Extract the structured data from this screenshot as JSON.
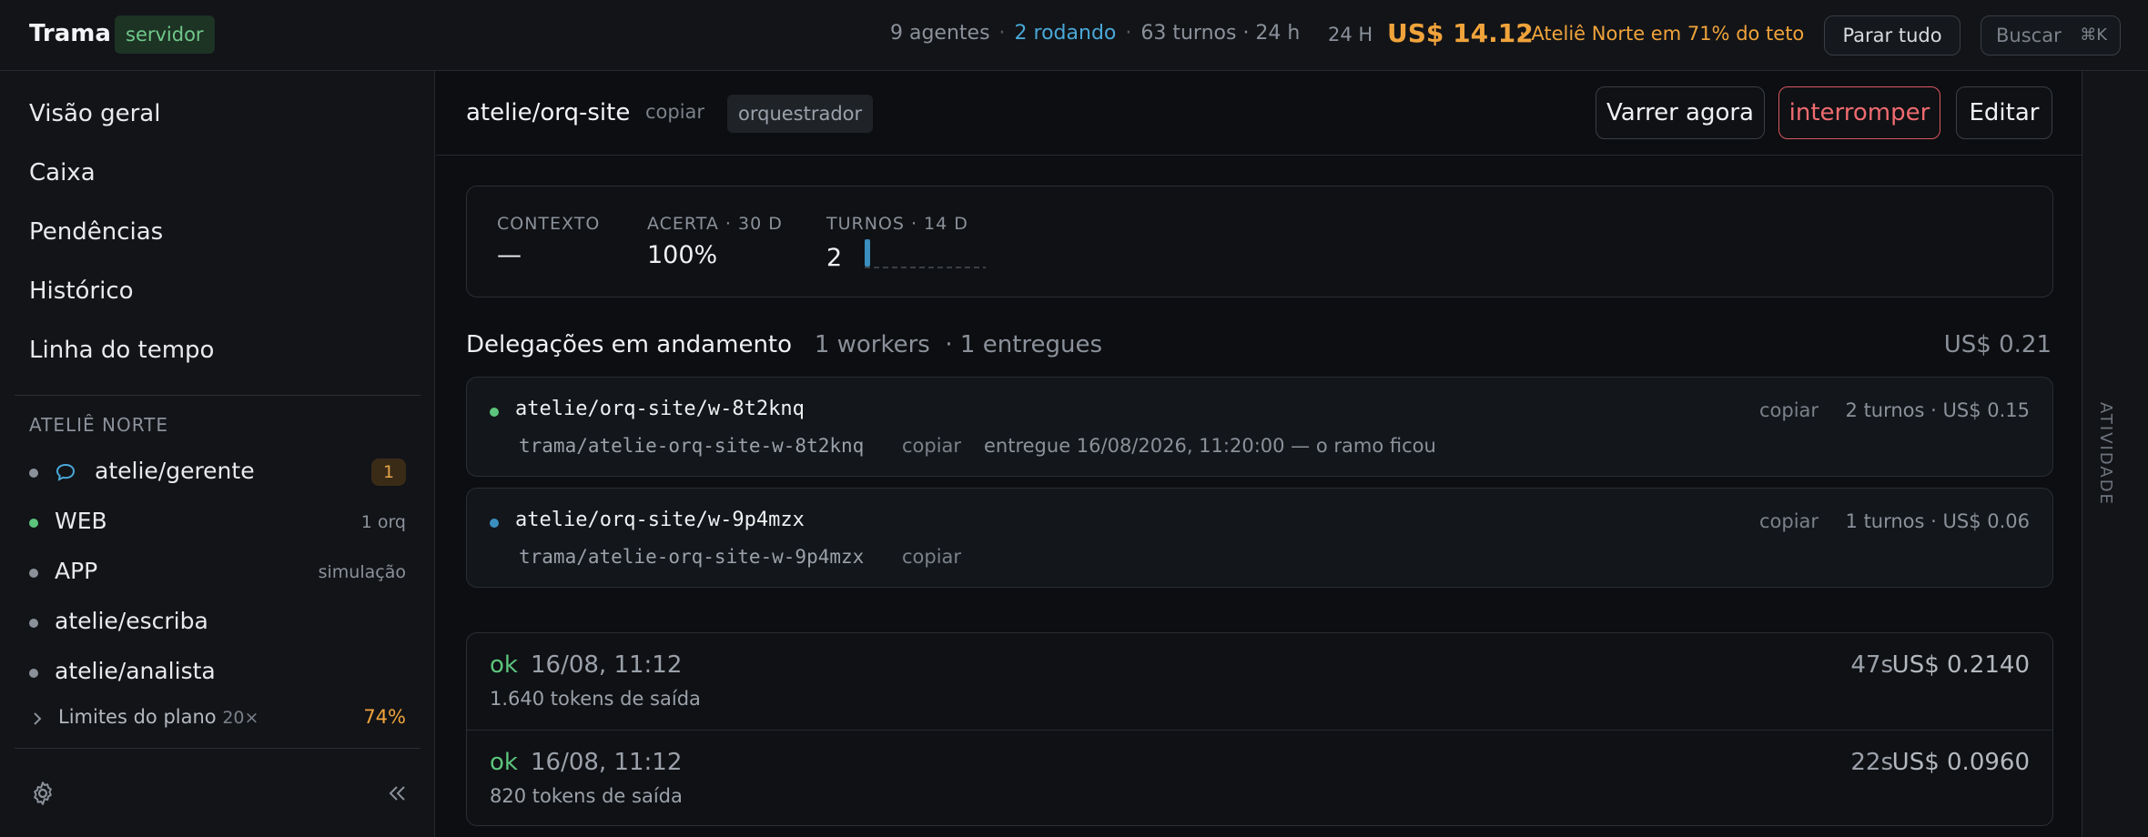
{
  "app": {
    "name": "Trama",
    "mode_tag": "servidor"
  },
  "topbar": {
    "agents": "9 agentes",
    "running": "2 rodando",
    "turns": "63 turnos · 24 h",
    "cost_label": "24 H",
    "cost": "US$ 14.12",
    "warning": "· Ateliê Norte em 71% do teto",
    "stop_all": "Parar tudo",
    "search": "Buscar",
    "search_shortcut": "⌘K"
  },
  "sidebar": {
    "nav": [
      "Visão geral",
      "Caixa",
      "Pendências",
      "Histórico",
      "Linha do tempo"
    ],
    "section_label": "ATELIÊ NORTE",
    "projects": [
      {
        "name": "atelie/gerente",
        "badge": "1",
        "dot_color": "#8b919a",
        "icon": "chat-bubble-icon"
      },
      {
        "name": "WEB",
        "meta": "1 orq",
        "dot_color": "#5cc47c"
      },
      {
        "name": "APP",
        "meta": "simulação",
        "dot_color": "#8b919a"
      },
      {
        "name": "atelie/escriba",
        "dot_color": "#8b919a"
      },
      {
        "name": "atelie/analista",
        "dot_color": "#8b919a"
      }
    ],
    "limits": {
      "label": "Limites do plano",
      "multiplier": "20×",
      "percent": "74%"
    }
  },
  "header": {
    "agent": "atelie/orq-site",
    "copy": "copiar",
    "role": "orquestrador",
    "sweep": "Varrer agora",
    "interrupt": "interromper",
    "edit": "Editar"
  },
  "stats": {
    "context_label": "CONTEXTO",
    "context_value": "—",
    "accuracy_label": "ACERTA · 30 D",
    "accuracy_value": "100%",
    "turns_label": "TURNOS · 14 D",
    "turns_value": "2",
    "turns_series": [
      0,
      0,
      0,
      0,
      0,
      0,
      0,
      0,
      0,
      0,
      0,
      0,
      0,
      2
    ]
  },
  "delegations": {
    "title": "Delegações em andamento",
    "workers": "1 workers",
    "delivered": "· 1 entregues",
    "cost": "US$ 0.21",
    "items": [
      {
        "name": "atelie/orq-site/w-8t2knq",
        "copy": "copiar",
        "meta": "2 turnos · US$ 0.15",
        "branch": "trama/atelie-orq-site-w-8t2knq",
        "branch_copy": "copiar",
        "status": "entregue 16/08/2026, 11:20:00 — o ramo ficou",
        "dot_color": "#5cc47c"
      },
      {
        "name": "atelie/orq-site/w-9p4mzx",
        "copy": "copiar",
        "meta": "1 turnos · US$ 0.06",
        "branch": "trama/atelie-orq-site-w-9p4mzx",
        "branch_copy": "copiar",
        "status": "",
        "dot_color": "#3a8fbf"
      }
    ]
  },
  "runs": [
    {
      "status": "ok",
      "time": "16/08, 11:12",
      "tokens": "1.640 tokens de saída",
      "duration": "47s",
      "cost": "US$ 0.2140"
    },
    {
      "status": "ok",
      "time": "16/08, 11:12",
      "tokens": "820 tokens de saída",
      "duration": "22s",
      "cost": "US$ 0.0960"
    }
  ],
  "activity": {
    "label": "ATIVIDADE"
  },
  "colors": {
    "accent_orange": "#f0a33b",
    "accent_blue": "#4aa8d8",
    "ok_green": "#5cc47c",
    "danger_red": "#ef6b70"
  }
}
